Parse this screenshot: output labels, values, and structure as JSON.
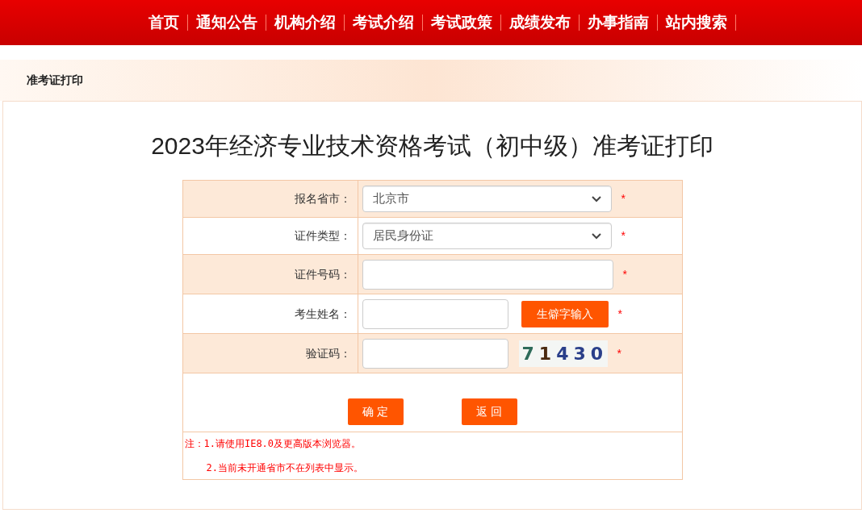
{
  "nav": [
    "首页",
    "通知公告",
    "机构介绍",
    "考试介绍",
    "考试政策",
    "成绩发布",
    "办事指南",
    "站内搜索"
  ],
  "breadcrumb": "准考证打印",
  "title": "2023年经济专业技术资格考试（初中级）准考证打印",
  "form_rows": [
    {
      "kind": "select",
      "label": "报名省市：",
      "value": "北京市",
      "required_mark": "*"
    },
    {
      "kind": "select",
      "label": "证件类型：",
      "value": "居民身份证",
      "required_mark": "*"
    },
    {
      "kind": "input",
      "label": "证件号码：",
      "required_mark": "*"
    },
    {
      "kind": "input_button",
      "label": "考生姓名：",
      "button": "生僻字输入",
      "required_mark": "*"
    },
    {
      "kind": "captcha",
      "label": "验证码：",
      "captcha": "71430",
      "required_mark": "*"
    }
  ],
  "buttons": [
    "确 定",
    "返 回"
  ],
  "notes": [
    "注：1.请使用IE8.0及更高版本浏览器。",
    "2.当前未开通省市不在列表中显示。"
  ]
}
